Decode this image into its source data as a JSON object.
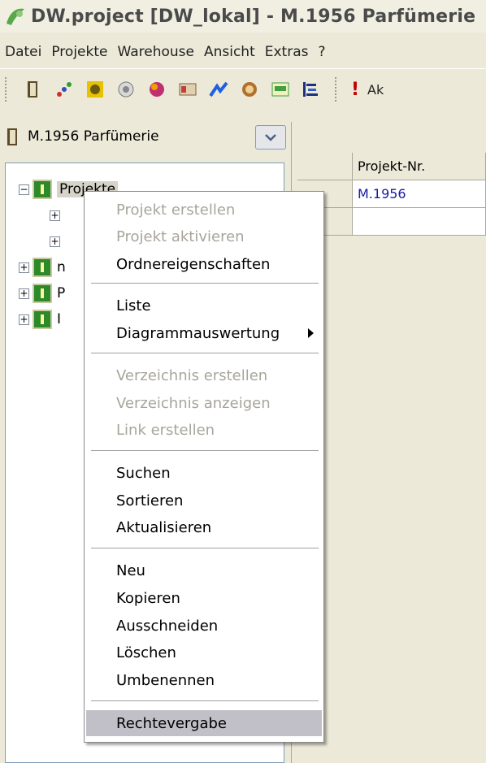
{
  "window": {
    "title": "DW.project [DW_lokal] - M.1956 Parfümerie"
  },
  "menubar": {
    "items": [
      "Datei",
      "Projekte",
      "Warehouse",
      "Ansicht",
      "Extras",
      "?"
    ]
  },
  "toolbar": {
    "icons": [
      "binder-icon",
      "chart-icon",
      "safe-icon",
      "gear-icon",
      "cube-icon",
      "card-icon",
      "graph-icon",
      "globe-icon",
      "report-icon",
      "gantt-icon"
    ],
    "alert_label": "Ak"
  },
  "project_selector": {
    "selected": "M.1956 Parfümerie"
  },
  "tree": {
    "root_label": "Projekte",
    "items": [
      "n",
      "P",
      "I"
    ]
  },
  "grid": {
    "column_header": "Projekt-Nr.",
    "rows": [
      "M.1956",
      ""
    ]
  },
  "context_menu": {
    "items": [
      {
        "label": "Projekt erstellen",
        "disabled": true
      },
      {
        "label": "Projekt aktivieren",
        "disabled": true
      },
      {
        "label": "Ordnereigenschaften",
        "disabled": false
      },
      {
        "label": "Liste",
        "disabled": false
      },
      {
        "label": "Diagrammauswertung",
        "disabled": false,
        "submenu": true
      },
      {
        "label": "Verzeichnis erstellen",
        "disabled": true
      },
      {
        "label": "Verzeichnis anzeigen",
        "disabled": true
      },
      {
        "label": "Link erstellen",
        "disabled": true
      },
      {
        "label": "Suchen",
        "disabled": false
      },
      {
        "label": "Sortieren",
        "disabled": false
      },
      {
        "label": "Aktualisieren",
        "disabled": false
      },
      {
        "label": "Neu",
        "disabled": false
      },
      {
        "label": "Kopieren",
        "disabled": false
      },
      {
        "label": "Ausschneiden",
        "disabled": false
      },
      {
        "label": "Löschen",
        "disabled": false
      },
      {
        "label": "Umbenennen",
        "disabled": false
      },
      {
        "label": "Rechtevergabe",
        "disabled": false,
        "highlighted": true
      }
    ]
  },
  "colors": {
    "title_text": "#4a4a4a",
    "folder_green": "#2d8a2b",
    "highlight": "#c1c0c8",
    "link_blue": "#1a1aa6"
  }
}
